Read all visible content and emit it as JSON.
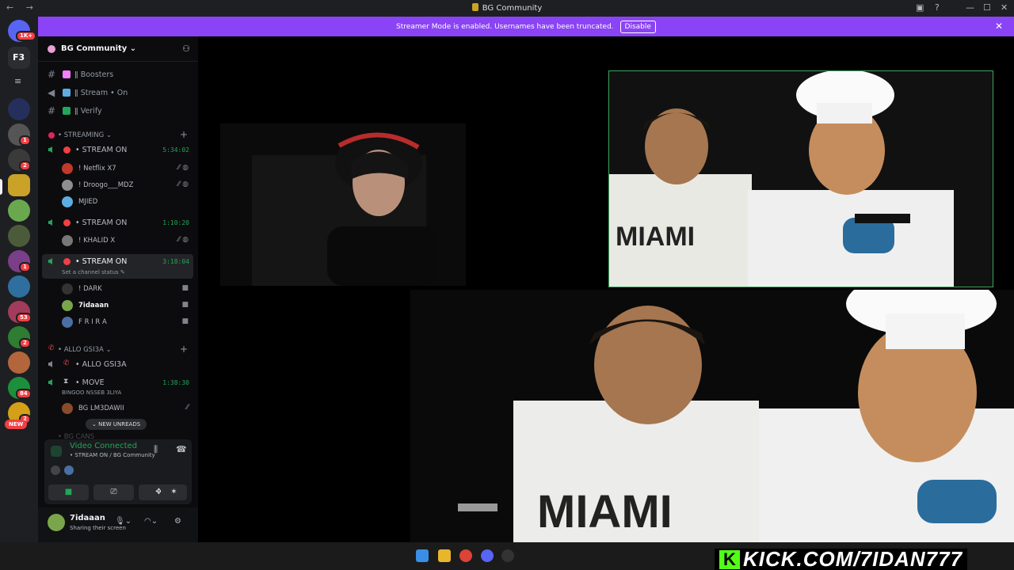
{
  "window": {
    "title": "BG Community",
    "controls": [
      "inbox-icon",
      "help-icon",
      "minimize-icon",
      "maximize-icon",
      "close-icon"
    ]
  },
  "banner": {
    "text": "Streamer Mode is enabled. Usernames have been truncated.",
    "button": "Disable"
  },
  "servers": [
    {
      "badge": "1K+"
    },
    {
      "badge": ""
    },
    {
      "badge": ""
    },
    {
      "badge": ""
    },
    {
      "badge": "1"
    },
    {
      "badge": "2"
    },
    {
      "badge": ""
    },
    {
      "badge": ""
    },
    {
      "badge": ""
    },
    {
      "badge": "1"
    },
    {
      "badge": ""
    },
    {
      "badge": "53"
    },
    {
      "badge": "2"
    },
    {
      "badge": ""
    },
    {
      "badge": "84"
    },
    {
      "badge": "2"
    }
  ],
  "rail_new": "NEW",
  "guild": {
    "name": "BG Community"
  },
  "channels": [
    {
      "label": "ǁ Boosters"
    },
    {
      "label": "ǁ Stream • On"
    },
    {
      "label": "ǁ Verify"
    }
  ],
  "categories": {
    "streaming": "• STREAMING",
    "allo": "• ALLO GSI3A",
    "bgcans": "• BG CANS"
  },
  "voice_channels": [
    {
      "label": "• STREAM ON",
      "time": "5:34:02"
    },
    {
      "label": "• STREAM ON",
      "time": "1:10:20"
    },
    {
      "label": "• STREAM ON",
      "time": "3:18:04",
      "status": "Set a channel status"
    },
    {
      "label": "• ALLO GSI3A",
      "time": ""
    },
    {
      "label": "• MOVE",
      "time": "1:38:30",
      "status": "BINGOO NSSEB 3LIYA"
    }
  ],
  "users": {
    "vc1": [
      "! Netflix X7",
      "! Droogo___MDZ",
      "MJIED"
    ],
    "vc2": [
      "! KHALID X"
    ],
    "vc3": [
      "! DARK",
      "7idaaan",
      "F R I R A"
    ],
    "move": [
      "BG LM3DAWII"
    ]
  },
  "new_unreads": "NEW UNREADS",
  "voice_panel": {
    "status": "Video Connected",
    "sub": "• STREAM ON / BG Community"
  },
  "user_panel": {
    "name": "7idaaan",
    "status": "Sharing their screen"
  },
  "overlay": {
    "kick_url": "KICK.COM/7IDAN777",
    "kick_letter": "K"
  }
}
